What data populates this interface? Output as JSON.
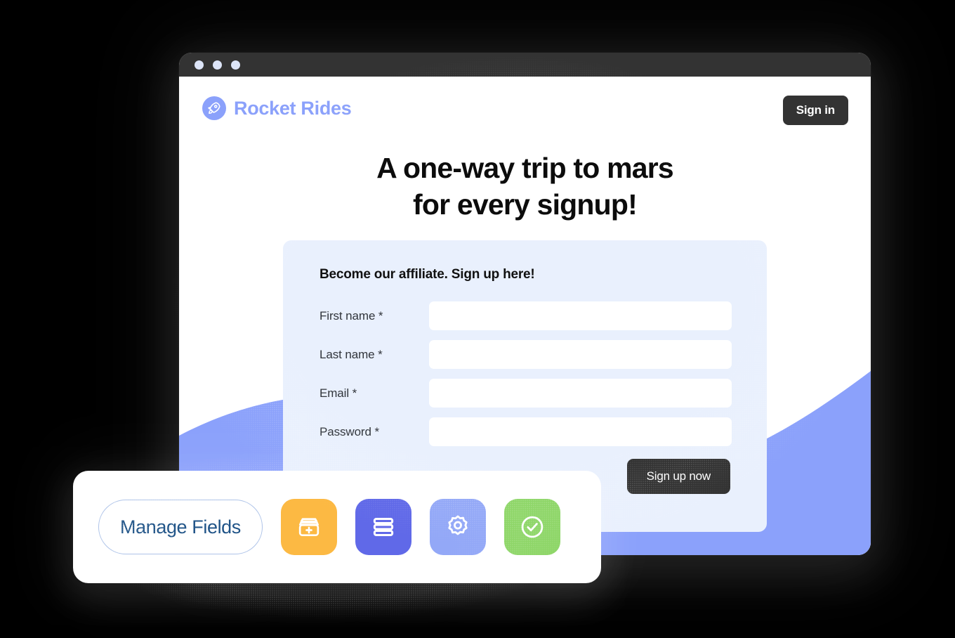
{
  "window": {
    "traffic_lights": [
      "close-dot",
      "minimize-dot",
      "maximize-dot"
    ]
  },
  "brand": {
    "name": "Rocket Rides",
    "logo_icon": "rocket-icon",
    "logo_bg": "#8ba1fb",
    "text_color": "#8ba1fb"
  },
  "header": {
    "signin_label": "Sign in",
    "signin_bg": "#333333"
  },
  "hero": {
    "headline_line1": "A one-way trip to mars",
    "headline_line2": "for every signup!"
  },
  "form": {
    "title": "Become our affiliate. Sign up here!",
    "panel_bg": "#e9f0fd",
    "fields": [
      {
        "label": "First name *",
        "value": "",
        "placeholder": "",
        "name": "first-name"
      },
      {
        "label": "Last name *",
        "value": "",
        "placeholder": "",
        "name": "last-name"
      },
      {
        "label": "Email *",
        "value": "",
        "placeholder": "",
        "name": "email"
      },
      {
        "label": "Password *",
        "value": "",
        "placeholder": "",
        "name": "password"
      }
    ],
    "submit_label": "Sign up now",
    "submit_bg": "#333333"
  },
  "decor": {
    "wave_color": "#8ba1fb"
  },
  "toolbar": {
    "manage_fields_label": "Manage Fields",
    "manage_fields_text_color": "#1f5387",
    "manage_fields_border_color": "#aec3e8",
    "buttons": [
      {
        "icon": "add-box-icon",
        "color": "#fcb943",
        "label": "Add field"
      },
      {
        "icon": "list-rows-icon",
        "color": "#6069e8",
        "label": "Reorder fields"
      },
      {
        "icon": "gear-icon",
        "color": "#93a8f7",
        "label": "Field settings"
      },
      {
        "icon": "check-circle-icon",
        "color": "#8ed668",
        "label": "Validate fields"
      }
    ]
  }
}
